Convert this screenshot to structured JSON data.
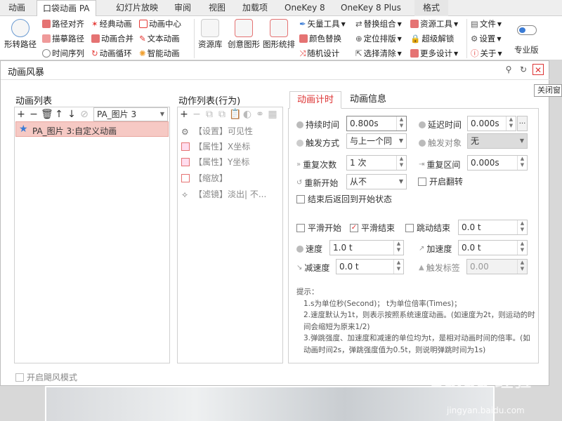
{
  "tabs": [
    "动画",
    "口袋动画 PA",
    "幻灯片放映",
    "审阅",
    "视图",
    "加载项",
    "OneKey 8",
    "OneKey 8 Plus",
    "格式"
  ],
  "ribbon": {
    "path_rotate": "形转路径",
    "col1": [
      "路径对齐",
      "描摹路径",
      "时间序列"
    ],
    "col2": [
      "经典动画",
      "动画合并",
      "动画循环"
    ],
    "col3": [
      "动画中心",
      "文本动画",
      "智能动画"
    ],
    "big1": "资源库",
    "big2": "创意图形",
    "big3": "图形统排",
    "col4": [
      "矢量工具",
      "颜色替换",
      "随机设计"
    ],
    "col5": [
      "替换组合",
      "定位排版",
      "选择清除"
    ],
    "col6": [
      "资源工具",
      "超级解锁",
      "更多设计"
    ],
    "col7": [
      "文件",
      "设置",
      "关于"
    ],
    "pro": "专业版"
  },
  "dialog": {
    "title": "动画风暴",
    "tooltip": "关闭窗",
    "anim_list_title": "动画列表",
    "anim_combo": "PA_图片 3",
    "anim_item": "PA_图片 3:自定义动画",
    "action_list_title": "动作列表(行为)",
    "actions": [
      "【设置】可见性",
      "【属性】X坐标",
      "【属性】Y坐标",
      "【缩放】",
      "【滤镜】淡出| 不..."
    ],
    "tab_timing": "动画计时",
    "tab_info": "动画信息",
    "duration_label": "持续时间",
    "duration_value": "0.800s",
    "delay_label": "延迟时间",
    "delay_value": "0.000s",
    "trigger_label": "触发方式",
    "trigger_value": "与上一个同",
    "target_label": "触发对象",
    "target_value": "无",
    "repeat_label": "重复次数",
    "repeat_value": "1 次",
    "repeat_range_label": "重复区间",
    "repeat_range_value": "0.000s",
    "restart_label": "重新开始",
    "restart_value": "从不",
    "flip_label": "开启翻转",
    "return_label": "结束后返回到开始状态",
    "smooth_start": "平滑开始",
    "smooth_end": "平滑结束",
    "bounce_end": "跳动结束",
    "bounce_value": "0.0 t",
    "speed_label": "速度",
    "speed_value": "1.0 t",
    "accel_label": "加速度",
    "accel_value": "0.0 t",
    "decel_label": "减速度",
    "decel_value": "0.0 t",
    "trigger_tag_label": "触发标签",
    "trigger_tag_value": "0.00",
    "hint_title": "提示：",
    "hint_lines": [
      "1.s为单位秒(Second)； t为单位倍率(Times)；",
      "2.速度默认为1t，则表示按照系统速度动画。(如速度为2t，则运动的时间会缩短为原来1/2)",
      "3.弹跳强度、加速度和减速的单位均为t，是相对动画时间的倍率。(如动画时间2s，弹跳强度值为0.5t，则说明弹跳时间为1s)"
    ],
    "storm_mode": "开启飓风模式"
  },
  "watermark": "Baidu 经验",
  "watermark_url": "jingyan.baidu.com"
}
